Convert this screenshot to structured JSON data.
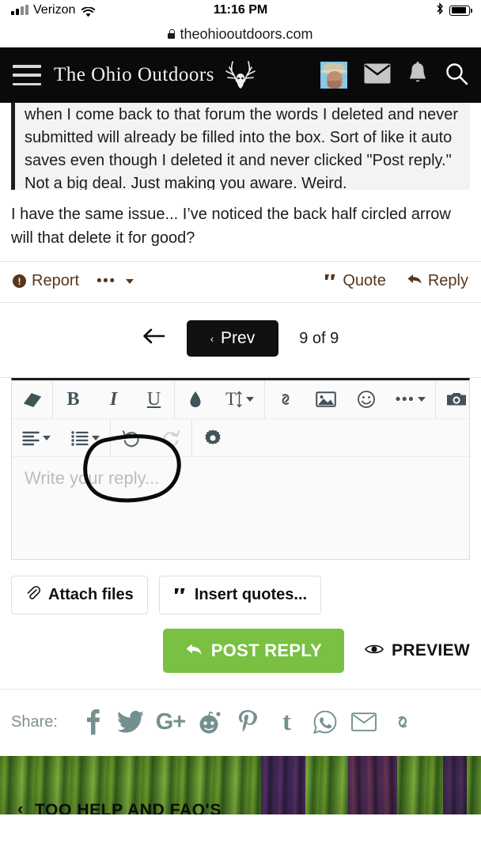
{
  "statusbar": {
    "carrier": "Verizon",
    "time": "11:16 PM",
    "signal_icon": "cell-signal-icon",
    "wifi_icon": "wifi-icon",
    "bluetooth_icon": "bluetooth-icon",
    "battery_icon": "battery-icon"
  },
  "urlbar": {
    "lock_icon": "lock-icon",
    "url": "theohiooutdoors.com"
  },
  "header": {
    "menu_icon": "hamburger-menu-icon",
    "brand": "The Ohio Outdoors",
    "logo_icon": "deer-antlers-icon",
    "avatar_icon": "user-avatar",
    "mail_icon": "envelope-icon",
    "bell_icon": "bell-icon",
    "search_icon": "search-icon"
  },
  "post": {
    "quote_text": "when I come back to that forum the words I deleted and never submitted will already be filled into the box. Sort of like it auto saves even though I deleted it and never clicked \"Post reply.\" Not a big deal. Just making you aware. Weird.",
    "body_text": "I have the same issue... I’ve noticed the back half circled arrow will that delete it for good?",
    "actions": {
      "report": "Report",
      "report_icon": "warning-circle-icon",
      "more_icon": "more-dots-icon",
      "quote": "Quote",
      "quote_icon": "quote-marks-icon",
      "reply": "Reply",
      "reply_icon": "reply-arrow-icon"
    },
    "accent_color": "#59361a"
  },
  "pagination": {
    "back_icon": "back-arrow-icon",
    "prev_label": "Prev",
    "prev_caret": "‹",
    "page_count": "9 of 9"
  },
  "editor": {
    "toolbar_row1": [
      {
        "name": "eraser-icon",
        "label": ""
      },
      {
        "name": "bold-icon",
        "label": "B"
      },
      {
        "name": "italic-icon",
        "label": "I"
      },
      {
        "name": "underline-icon",
        "label": "U"
      },
      {
        "name": "text-color-drop-icon",
        "label": ""
      },
      {
        "name": "font-size-icon",
        "label": "T"
      },
      {
        "name": "link-icon",
        "label": ""
      },
      {
        "name": "image-icon",
        "label": ""
      },
      {
        "name": "smiley-icon",
        "label": ""
      },
      {
        "name": "more-dots-icon",
        "label": ""
      },
      {
        "name": "camera-icon",
        "label": ""
      }
    ],
    "toolbar_row2": [
      {
        "name": "align-left-icon",
        "label": ""
      },
      {
        "name": "bullet-list-icon",
        "label": ""
      },
      {
        "name": "undo-icon",
        "label": ""
      },
      {
        "name": "redo-icon",
        "label": ""
      },
      {
        "name": "gear-icon",
        "label": ""
      }
    ],
    "reply_placeholder": "Write your reply...",
    "reply_value": "",
    "attach_label": "Attach files",
    "attach_icon": "paperclip-icon",
    "insert_quotes_label": "Insert quotes...",
    "insert_quotes_icon": "quote-marks-icon",
    "post_reply_label": "POST REPLY",
    "post_reply_icon": "reply-arrow-icon",
    "post_reply_color": "#7ac143",
    "preview_label": "PREVIEW",
    "preview_icon": "eye-icon"
  },
  "share": {
    "label": "Share:",
    "icons": [
      "facebook-icon",
      "twitter-icon",
      "google-plus-icon",
      "reddit-icon",
      "pinterest-icon",
      "tumblr-icon",
      "whatsapp-icon",
      "email-icon",
      "link-icon"
    ],
    "color": "#74908e"
  },
  "footer": {
    "chevron": "‹",
    "text": "TOO HELP AND FAQ'S"
  },
  "annotation": {
    "name": "handdrawn-circle-annotation",
    "color": "#0a0a0a"
  }
}
